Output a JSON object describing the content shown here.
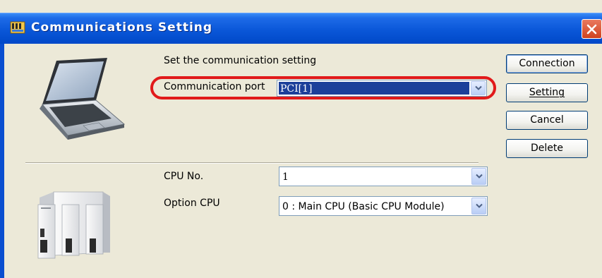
{
  "window": {
    "title": "Communications Setting"
  },
  "pc_section": {
    "heading": "Set the communication setting",
    "port_label": "Communication port",
    "port_value": "PCI[1]"
  },
  "cpu_section": {
    "cpu_no_label": "CPU No.",
    "cpu_no_value": "1",
    "option_label": "Option CPU",
    "option_value": "0 : Main CPU (Basic CPU Module)"
  },
  "buttons": {
    "connection": "Connection",
    "setting": "Setting",
    "cancel": "Cancel",
    "delete": "Delete"
  },
  "icons": {
    "app": "communications-app-icon",
    "close": "close-icon",
    "laptop": "laptop-icon",
    "plc": "plc-rack-icon"
  },
  "colors": {
    "titlebar": "#0a57d8",
    "dialog_bg": "#ece9d8",
    "highlight": "#e11a1a",
    "selection": "#1c3f9a"
  }
}
